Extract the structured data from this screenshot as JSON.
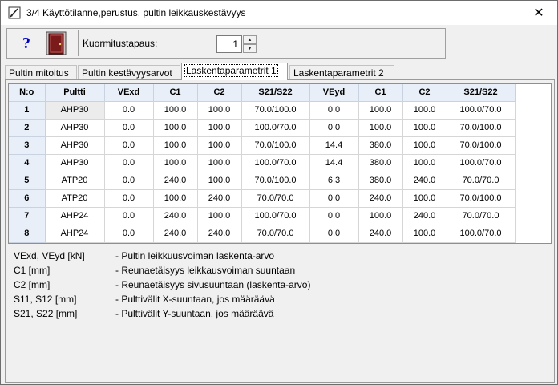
{
  "window": {
    "title": "3/4  Käyttötilanne,perustus, pultin leikkauskestävyys",
    "close_glyph": "✕"
  },
  "toolbar": {
    "help_glyph": "?",
    "load_case_label": "Kuormitustapaus:",
    "load_case_value": "1"
  },
  "tabs": [
    {
      "label": "Pultin mitoitus",
      "active": false
    },
    {
      "label": "Pultin kestävyysarvot",
      "active": false
    },
    {
      "label": "Laskentaparametrit 1",
      "active": true
    },
    {
      "label": "Laskentaparametrit 2",
      "active": false
    }
  ],
  "table": {
    "headers": [
      "N:o",
      "Pultti",
      "VExd",
      "C1",
      "C2",
      "S21/S22",
      "VEyd",
      "C1",
      "C2",
      "S21/S22"
    ],
    "rows": [
      [
        "1",
        "AHP30",
        "0.0",
        "100.0",
        "100.0",
        "70.0/100.0",
        "0.0",
        "100.0",
        "100.0",
        "100.0/70.0"
      ],
      [
        "2",
        "AHP30",
        "0.0",
        "100.0",
        "100.0",
        "100.0/70.0",
        "0.0",
        "100.0",
        "100.0",
        "70.0/100.0"
      ],
      [
        "3",
        "AHP30",
        "0.0",
        "100.0",
        "100.0",
        "70.0/100.0",
        "14.4",
        "380.0",
        "100.0",
        "70.0/100.0"
      ],
      [
        "4",
        "AHP30",
        "0.0",
        "100.0",
        "100.0",
        "100.0/70.0",
        "14.4",
        "380.0",
        "100.0",
        "100.0/70.0"
      ],
      [
        "5",
        "ATP20",
        "0.0",
        "240.0",
        "100.0",
        "70.0/100.0",
        "6.3",
        "380.0",
        "240.0",
        "70.0/70.0"
      ],
      [
        "6",
        "ATP20",
        "0.0",
        "100.0",
        "240.0",
        "70.0/70.0",
        "0.0",
        "240.0",
        "100.0",
        "70.0/100.0"
      ],
      [
        "7",
        "AHP24",
        "0.0",
        "240.0",
        "100.0",
        "100.0/70.0",
        "0.0",
        "100.0",
        "240.0",
        "70.0/70.0"
      ],
      [
        "8",
        "AHP24",
        "0.0",
        "240.0",
        "240.0",
        "70.0/70.0",
        "0.0",
        "240.0",
        "100.0",
        "100.0/70.0"
      ]
    ]
  },
  "legend": [
    {
      "term": "VExd, VEyd [kN]",
      "desc": "- Pultin leikkuusvoiman laskenta-arvo"
    },
    {
      "term": "C1 [mm]",
      "desc": "- Reunaetäisyys leikkausvoiman suuntaan"
    },
    {
      "term": "C2 [mm]",
      "desc": "- Reunaetäisyys sivusuuntaan (laskenta-arvo)"
    },
    {
      "term": "S11, S12 [mm]",
      "desc": "- Pulttivälit X-suuntaan, jos määräävä"
    },
    {
      "term": "S21, S22 [mm]",
      "desc": "- Pulttivälit Y-suuntaan, jos määräävä"
    }
  ],
  "colors": {
    "header_bg": "#e9eff8",
    "grid_line": "#d6d6d6",
    "help_icon": "#0000c0",
    "exit_door": "#7a1a1a"
  }
}
